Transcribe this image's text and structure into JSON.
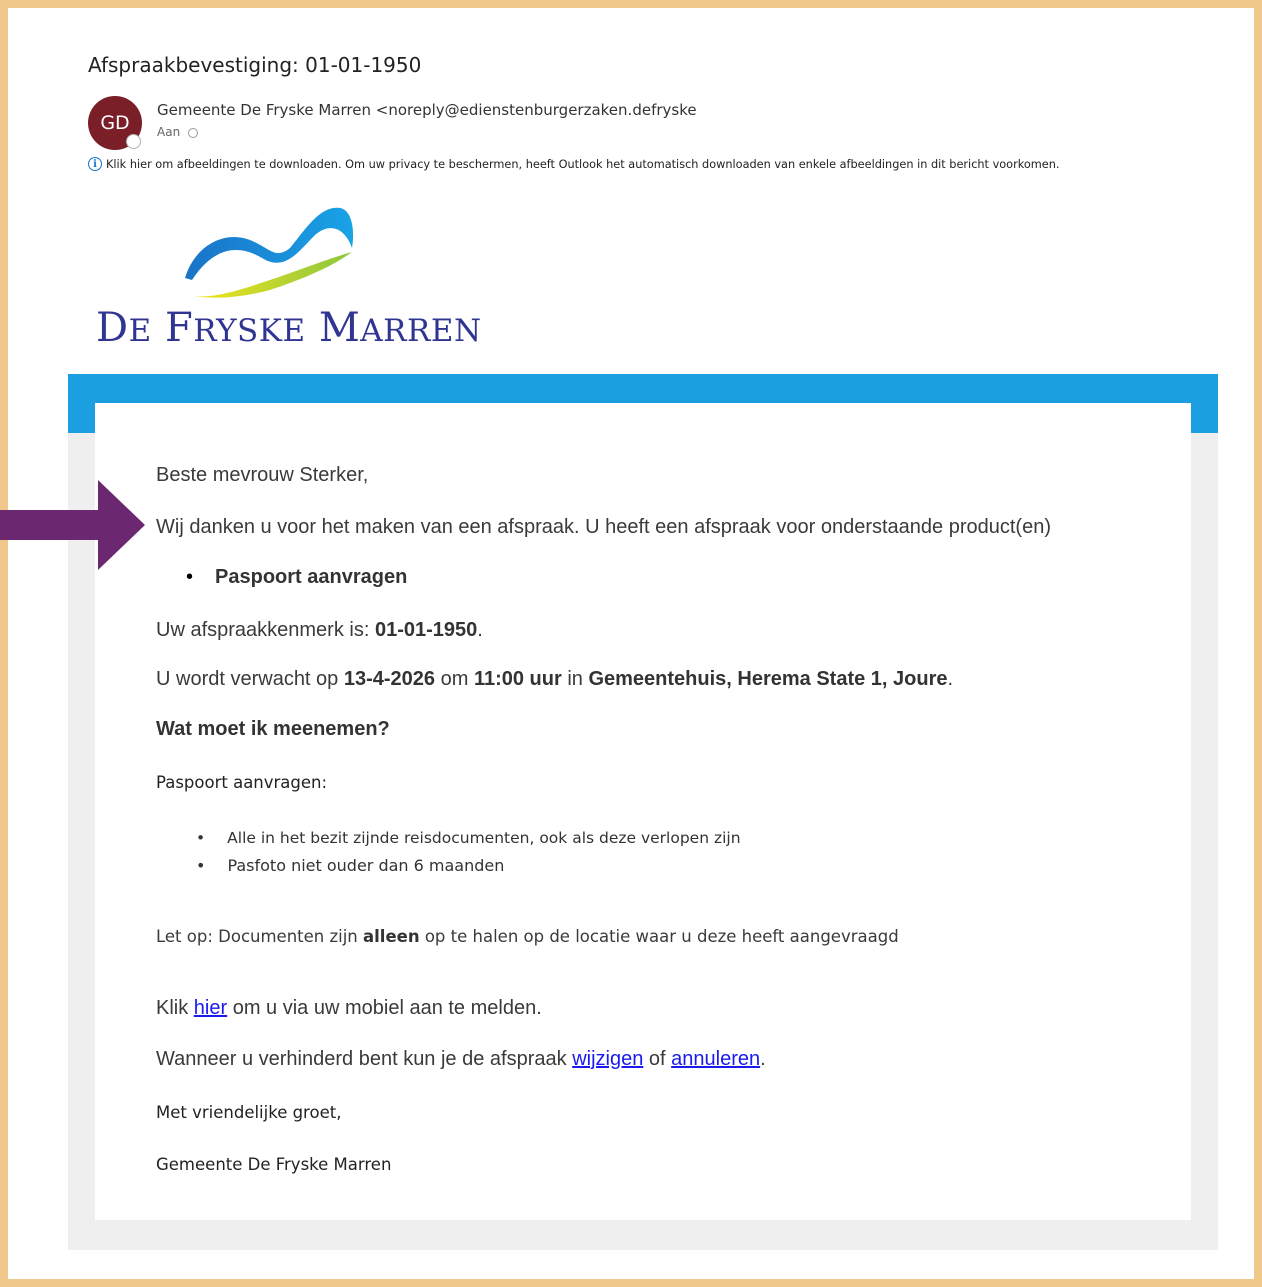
{
  "email": {
    "subject": "Afspraakbevestiging: 01-01-1950",
    "avatar_initials": "GD",
    "sender": "Gemeente De Fryske Marren <noreply@edienstenburgerzaken.defryskemarren.nl>",
    "to_label": "Aan",
    "info_text": "Klik hier om afbeeldingen te downloaden. Om uw privacy te beschermen, heeft Outlook het automatisch downloaden van enkele afbeeldingen in dit bericht voorkomen."
  },
  "logo": {
    "big1": "D",
    "small1": "E",
    "big2": "F",
    "small2": "RYSKE",
    "big3": "M",
    "small3": "ARREN"
  },
  "body": {
    "greeting": "Beste mevrouw Sterker,",
    "thanks": "Wij danken u voor het maken van een afspraak. U heeft een afspraak voor onderstaande product(en)",
    "product": "Paspoort aanvragen",
    "ref_prefix": "Uw afspraakkenmerk is: ",
    "ref_value": "01-01-1950",
    "ref_suffix": ".",
    "expected_prefix": "U wordt verwacht op ",
    "date": "13-4-2026",
    "om": " om ",
    "time": "11:00 uur",
    "in": " in ",
    "location": "Gemeentehuis, Herema State 1, Joure",
    "expected_suffix": ".",
    "bring_heading": "Wat moet ik meenemen?",
    "bring_sub": "Paspoort aanvragen:",
    "bring_items": [
      "Alle in het bezit zijnde reisdocumenten, ook als deze verlopen zijn",
      "Pasfoto niet ouder dan 6 maanden"
    ],
    "note_prefix": "Let op: Documenten zijn ",
    "note_bold": "alleen",
    "note_suffix": " op te halen op de locatie waar u deze heeft aangevraagd",
    "mobile_prefix": "Klik ",
    "mobile_link": "hier",
    "mobile_suffix": " om u via uw mobiel aan te melden.",
    "change_prefix": "Wanneer u verhinderd bent kun je de afspraak ",
    "change_link": "wijzigen",
    "change_of": " of ",
    "cancel_link": "annuleren",
    "change_suffix": ".",
    "closing": "Met vriendelijke groet,",
    "signature": "Gemeente De Fryske Marren"
  },
  "colors": {
    "frame": "#f0c88c",
    "blue_bar": "#1b9fe0",
    "avatar": "#7a1e28",
    "arrow": "#6b2770",
    "link": "#1a1aee",
    "logo_text": "#2f3590"
  }
}
